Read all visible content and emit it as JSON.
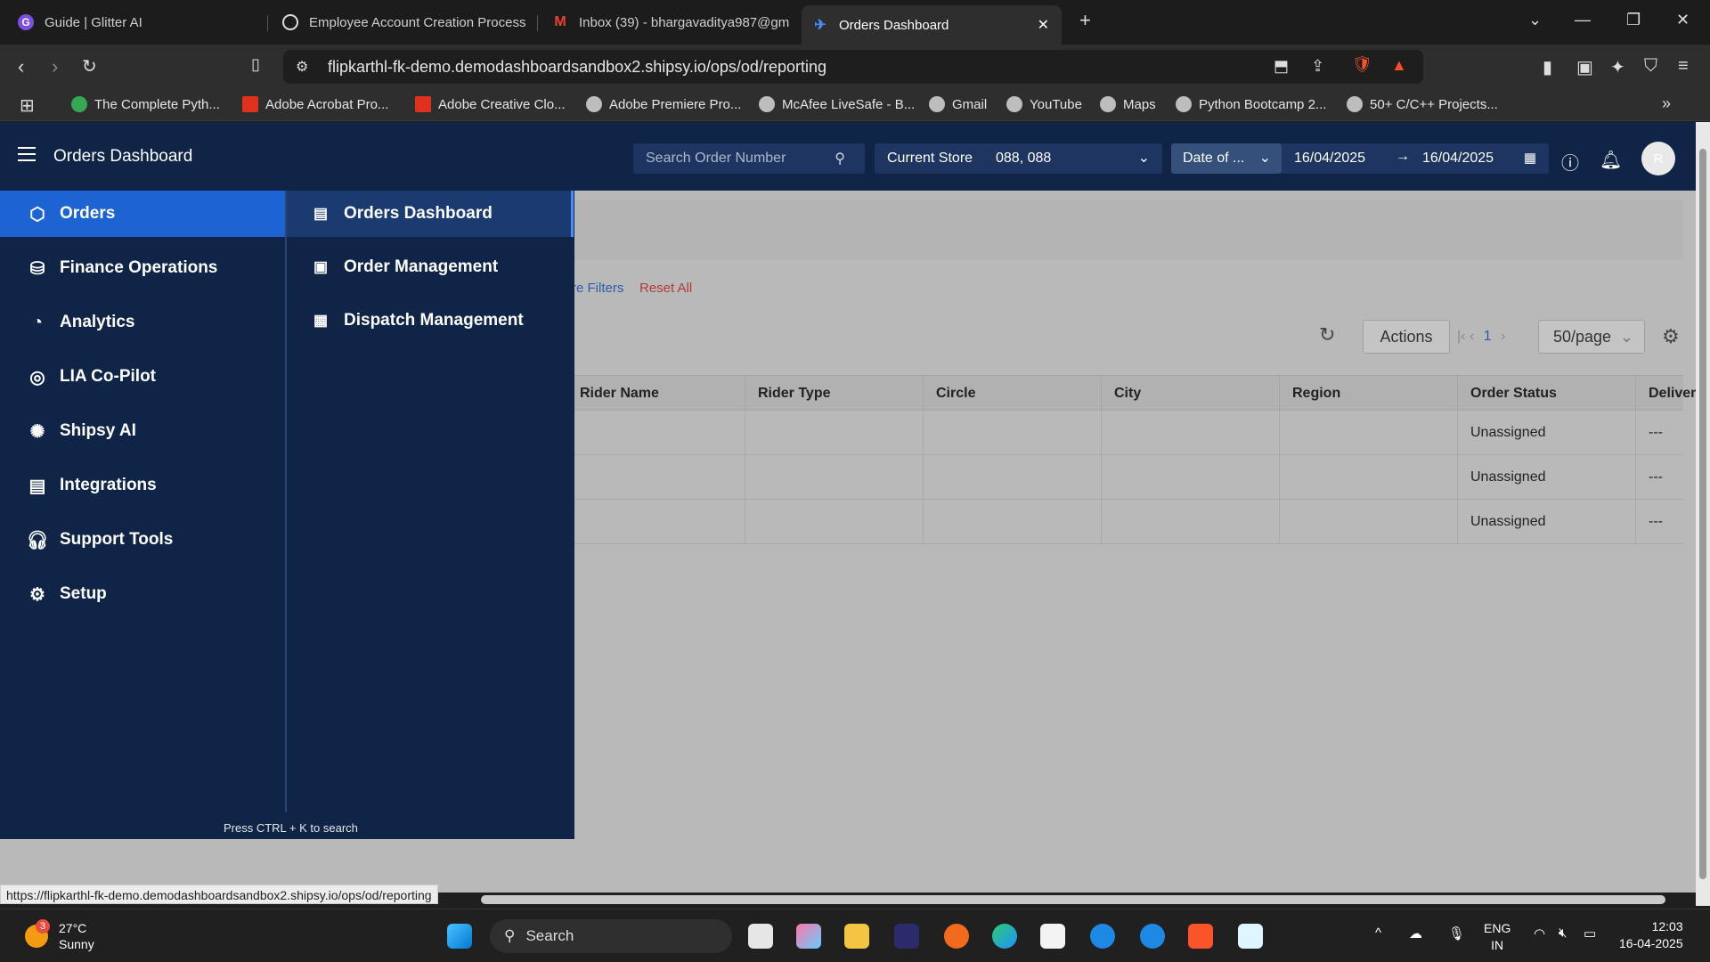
{
  "browser": {
    "tabs": [
      {
        "title": "Guide | Glitter AI",
        "icon": "glitter-icon"
      },
      {
        "title": "Employee Account Creation Process",
        "icon": "globe-icon"
      },
      {
        "title": "Inbox (39) - bhargavaditya987@gm",
        "icon": "gmail-icon"
      },
      {
        "title": "Orders Dashboard",
        "icon": "shipsy-icon",
        "active": true
      }
    ],
    "url": "flipkarthl-fk-demo.demodashboardsandbox2.shipsy.io/ops/od/reporting",
    "bookmarks": [
      "The Complete Pyth...",
      "Adobe Acrobat Pro...",
      "Adobe Creative Clo...",
      "Adobe Premiere Pro...",
      "McAfee LiveSafe - B...",
      "Gmail",
      "YouTube",
      "Maps",
      "Python Bootcamp 2...",
      "50+ C/C++ Projects..."
    ],
    "status_url": "https://flipkarthl-fk-demo.demodashboardsandbox2.shipsy.io/ops/od/reporting"
  },
  "header": {
    "title": "Orders Dashboard",
    "search_placeholder": "Search Order Number",
    "store_label": "Current Store",
    "store_value": "088, 088",
    "date_type": "Date of ...",
    "date_from": "16/04/2025",
    "date_to": "16/04/2025",
    "avatar_initial": "R"
  },
  "nav": {
    "primary": [
      {
        "label": "Orders",
        "icon": "box-icon",
        "active": true
      },
      {
        "label": "Finance Operations",
        "icon": "finance-icon"
      },
      {
        "label": "Analytics",
        "icon": "pie-chart-icon"
      },
      {
        "label": "LIA Co-Pilot",
        "icon": "copilot-icon"
      },
      {
        "label": "Shipsy AI",
        "icon": "brain-icon"
      },
      {
        "label": "Integrations",
        "icon": "integration-icon"
      },
      {
        "label": "Support Tools",
        "icon": "headset-icon"
      },
      {
        "label": "Setup",
        "icon": "gear-icon"
      }
    ],
    "secondary": [
      {
        "label": "Orders Dashboard",
        "icon": "table-icon",
        "active": true
      },
      {
        "label": "Order Management",
        "icon": "document-icon"
      },
      {
        "label": "Dispatch Management",
        "icon": "dispatch-icon"
      }
    ],
    "hint": "Press CTRL + K to search"
  },
  "content": {
    "more_filters": "re Filters",
    "reset_all": "Reset All",
    "actions_label": "Actions",
    "page_number": "1",
    "per_page": "50/page",
    "columns": [
      "Rider Name",
      "Rider Type",
      "Circle",
      "City",
      "Region",
      "Order Status",
      "Deliver"
    ],
    "rows": [
      {
        "order_status": "Unassigned",
        "deliver": "---"
      },
      {
        "order_status": "Unassigned",
        "deliver": "---"
      },
      {
        "order_status": "Unassigned",
        "deliver": "---"
      }
    ]
  },
  "taskbar": {
    "temp": "27°C",
    "condition": "Sunny",
    "weather_badge": "3",
    "search_label": "Search",
    "lang1": "ENG",
    "lang2": "IN",
    "time": "12:03",
    "date": "16-04-2025"
  }
}
